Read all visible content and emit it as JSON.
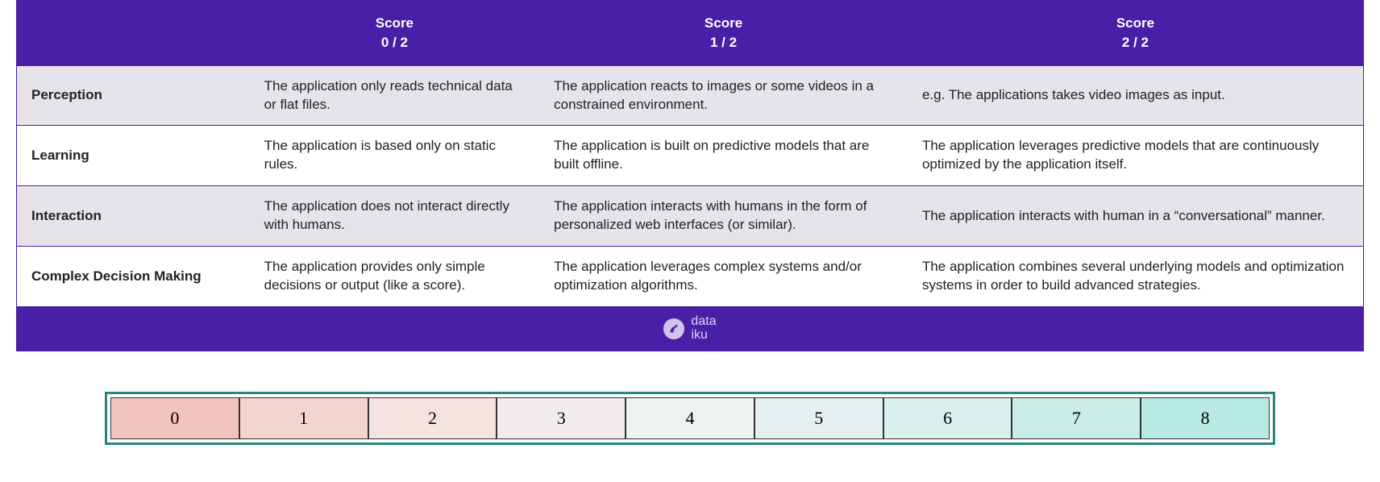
{
  "headers": {
    "score_label": "Score",
    "col0": "0 / 2",
    "col1": "1 /  2",
    "col2": "2 / 2"
  },
  "rows": [
    {
      "name": "Perception",
      "c0": "The application only reads technical data or flat files.",
      "c1": "The application reacts to images or some videos in a constrained environment.",
      "c2": "e.g. The applications takes video images as input."
    },
    {
      "name": "Learning",
      "c0": " The application is based only on static rules.",
      "c1": "The application is built on predictive models that are built offline.",
      "c2": "The application leverages predictive models that are continuously optimized by the application itself."
    },
    {
      "name": "Interaction",
      "c0": "The application does not interact directly with humans.",
      "c1": "The application interacts with humans in the form of personalized web interfaces (or similar).",
      "c2": "The application interacts with human in a “conversational” manner."
    },
    {
      "name": "Complex Decision Making",
      "c0": "The application provides only simple decisions or output (like a score).",
      "c1": "The application leverages complex systems and/or optimization algorithms.",
      "c2": "The application combines several underlying models and optimization systems in order to build advanced strategies."
    }
  ],
  "footer": {
    "line1": "data",
    "line2": "iku"
  },
  "scale": {
    "values": [
      "0",
      "1",
      "2",
      "3",
      "4",
      "5",
      "6",
      "7",
      "8"
    ],
    "colors": [
      "#f2c4bf",
      "#f3d5d0",
      "#f4e3e0",
      "#f2edec",
      "#edf2f2",
      "#e5f1f0",
      "#daf0ed",
      "#caece7",
      "#b9eae2"
    ]
  }
}
